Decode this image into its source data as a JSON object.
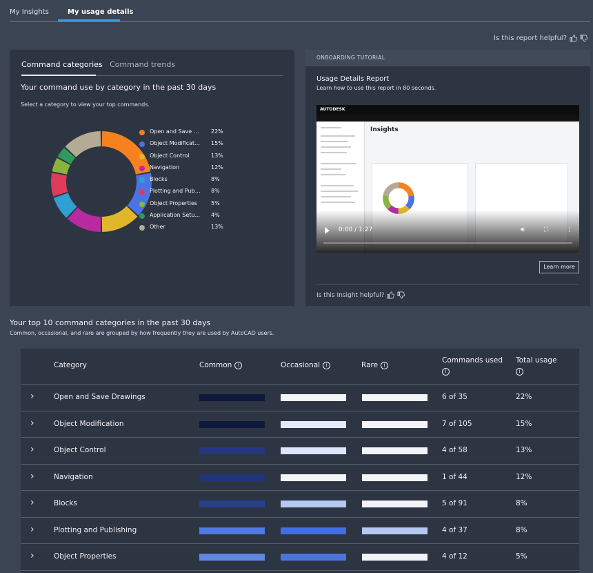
{
  "top_tabs": [
    "My Insights",
    "My usage details"
  ],
  "report_helpful": "Is this report helpful?",
  "left_panel": {
    "tabs": [
      "Command categories",
      "Command trends"
    ],
    "heading": "Your command use by category in the past 30 days",
    "subheading": "Select a category to view your top commands."
  },
  "chart_data": {
    "type": "pie",
    "variant": "donut",
    "categories": [
      "Open and Save Dr...",
      "Object Modificati...",
      "Object Control",
      "Navigation",
      "Blocks",
      "Plotting and Publ...",
      "Object Properties",
      "Application Setu...",
      "Other"
    ],
    "values": [
      22,
      15,
      13,
      12,
      8,
      8,
      5,
      4,
      13
    ],
    "labels": [
      "22%",
      "15%",
      "13%",
      "12%",
      "8%",
      "8%",
      "5%",
      "4%",
      "13%"
    ],
    "colors": [
      "#f5811f",
      "#4a74e6",
      "#e0b62a",
      "#b72aa0",
      "#2f9fd4",
      "#e03a5a",
      "#8ab43d",
      "#2e9a5c",
      "#b5ab95"
    ]
  },
  "onboarding": {
    "header": "ONBOARDING TUTORIAL",
    "title": "Usage Details Report",
    "subtitle": "Learn how to use this report in 80 seconds.",
    "video": {
      "logo": "AUTODESK",
      "screen_title": "Insights",
      "time": "0:00 / 1:27"
    },
    "learn_more": "Learn more",
    "insight_helpful": "Is this Insight helpful?"
  },
  "table": {
    "title": "Your top 10 command categories in the past 30 days",
    "subtitle": "Common, occasional, and rare are grouped by how frequently they are used by AutoCAD users.",
    "headers": {
      "category": "Category",
      "common": "Common",
      "occasional": "Occasional",
      "rare": "Rare",
      "commands_used": "Commands used",
      "total_usage": "Total usage"
    },
    "rows": [
      {
        "category": "Open and Save Drawings",
        "common": "#0e1a3d",
        "occasional": "#f2f4f8",
        "rare": "#f2f4f8",
        "commands_used": "6 of 35",
        "total_usage": "22%"
      },
      {
        "category": "Object Modification",
        "common": "#0e1a3d",
        "occasional": "#e4ebfb",
        "rare": "#f2f4f8",
        "commands_used": "7 of 105",
        "total_usage": "15%"
      },
      {
        "category": "Object Control",
        "common": "#23387f",
        "occasional": "#dbe5fb",
        "rare": "#f2f4f8",
        "commands_used": "4 of 58",
        "total_usage": "13%"
      },
      {
        "category": "Navigation",
        "common": "#1f3479",
        "occasional": "#f2f4f8",
        "rare": "#f2f4f8",
        "commands_used": "1 of 44",
        "total_usage": "12%"
      },
      {
        "category": "Blocks",
        "common": "#283f8a",
        "occasional": "#b6c9f2",
        "rare": "#f2f4f8",
        "commands_used": "5 of 91",
        "total_usage": "8%"
      },
      {
        "category": "Plotting and Publishing",
        "common": "#4f7ae0",
        "occasional": "#3f6fe0",
        "rare": "#b5c8f0",
        "commands_used": "4 of 37",
        "total_usage": "8%"
      },
      {
        "category": "Object Properties",
        "common": "#5f87e4",
        "occasional": "#4a75de",
        "rare": "#f2f4f8",
        "commands_used": "4 of 12",
        "total_usage": "5%"
      }
    ]
  }
}
